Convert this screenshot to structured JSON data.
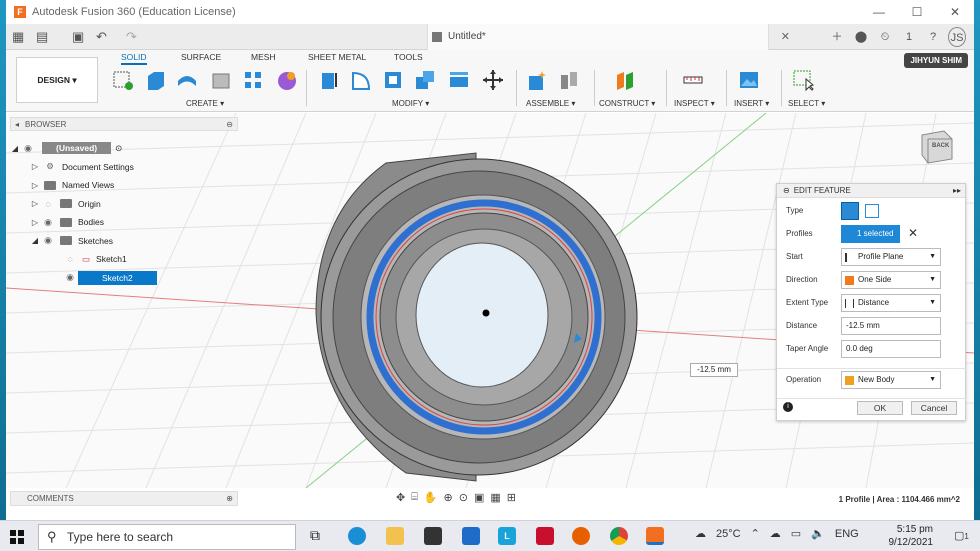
{
  "window": {
    "title": "Autodesk Fusion 360 (Education License)",
    "doc_tab": "Untitled*",
    "notif_count": "1",
    "avatar": "JS",
    "user": "JIHYUN SHIM"
  },
  "ribbon": {
    "tabs": [
      "SOLID",
      "SURFACE",
      "MESH",
      "SHEET METAL",
      "TOOLS"
    ],
    "workspace": "DESIGN",
    "groups": [
      "CREATE",
      "MODIFY",
      "ASSEMBLE",
      "CONSTRUCT",
      "INSPECT",
      "INSERT",
      "SELECT"
    ]
  },
  "browser": {
    "title": "BROWSER",
    "root": "(Unsaved)",
    "items": [
      "Document Settings",
      "Named Views",
      "Origin",
      "Bodies",
      "Sketches",
      "Sketch1",
      "Sketch2"
    ]
  },
  "comments": "COMMENTS",
  "viewcube": "BACK",
  "dimension": "-12.5 mm",
  "edit_feature": {
    "title": "EDIT FEATURE",
    "labels": [
      "Type",
      "Profiles",
      "Start",
      "Direction",
      "Extent Type",
      "Distance",
      "Taper Angle",
      "Operation"
    ],
    "profiles": "1 selected",
    "start": "Profile Plane",
    "direction": "One Side",
    "extent_type": "Distance",
    "distance": "-12.5 mm",
    "taper_angle": "0.0 deg",
    "operation": "New Body",
    "ok": "OK",
    "cancel": "Cancel"
  },
  "status": "1 Profile | Area : 1104.466 mm^2",
  "taskbar": {
    "search": "Type here to search",
    "temp": "25°C",
    "lang": "ENG",
    "time": "5:15 pm",
    "date": "9/12/2021",
    "notif": "1"
  }
}
